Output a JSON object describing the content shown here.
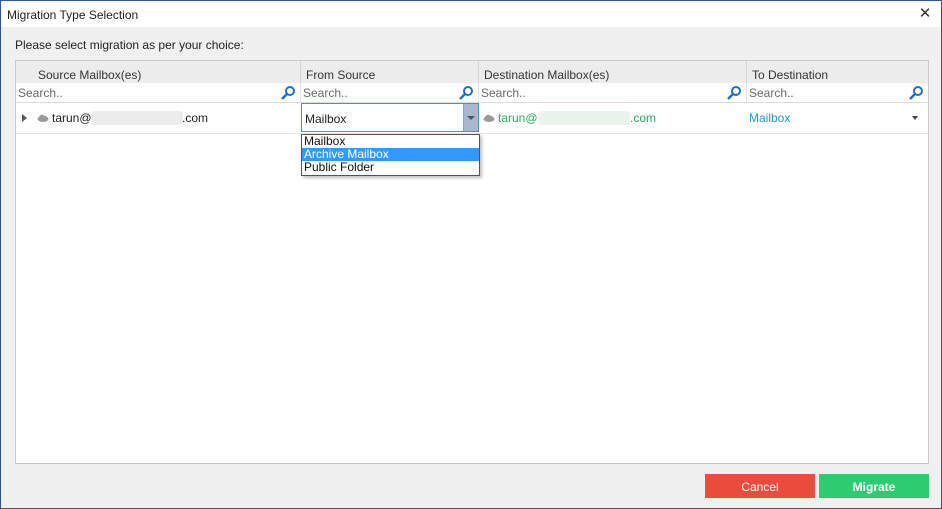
{
  "window": {
    "title": "Migration Type Selection",
    "close_glyph": "✕"
  },
  "instruction": "Please select migration as per your choice:",
  "grid": {
    "columns": [
      {
        "label": "Source Mailbox(es)"
      },
      {
        "label": "From Source"
      },
      {
        "label": "Destination Mailbox(es)"
      },
      {
        "label": "To Destination"
      }
    ],
    "filters": [
      {
        "placeholder": "Search.."
      },
      {
        "placeholder": "Search.."
      },
      {
        "placeholder": "Search.."
      },
      {
        "placeholder": "Search.."
      }
    ],
    "rows": [
      {
        "source_prefix": "tarun@",
        "source_suffix": ".com",
        "from_source": "Mailbox",
        "destination_prefix": "tarun@",
        "destination_suffix": ".com",
        "to_destination": "Mailbox"
      }
    ]
  },
  "dropdown": {
    "options": [
      "Mailbox",
      "Archive Mailbox",
      "Public Folder"
    ],
    "highlighted": "Archive Mailbox"
  },
  "buttons": {
    "cancel": "Cancel",
    "migrate": "Migrate"
  },
  "colors": {
    "cancel": "#e74c3c",
    "migrate": "#2ecc71",
    "destination_text": "#27ae60",
    "link": "#1e9bd7",
    "highlight": "#3399ff"
  },
  "icons": {
    "cloud": "cloud-icon",
    "search": "search-icon",
    "expand": "expand-arrow-icon"
  }
}
